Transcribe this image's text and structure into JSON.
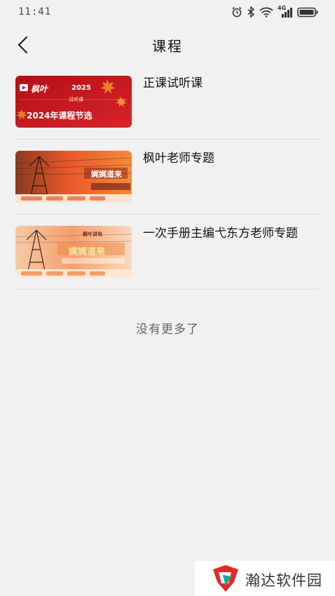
{
  "status_bar": {
    "time": "11:41",
    "icons": [
      "alarm-icon",
      "bluetooth-icon",
      "wifi-icon",
      "4g-signal-icon",
      "battery-icon"
    ],
    "network_label": "4G"
  },
  "header": {
    "title": "课程",
    "back_icon": "chevron-left-icon"
  },
  "courses": [
    {
      "title": "正课试听课",
      "thumbnail": {
        "brand": "枫叶",
        "year": "2025",
        "tag": "试听课",
        "headline": "2024年课程节选",
        "accent": "#c8171f"
      }
    },
    {
      "title": "枫叶老师专题",
      "thumbnail": {
        "headline": "娓娓道来",
        "accent": "#e8582a"
      }
    },
    {
      "title": "一次手册主编弋东方老师专题",
      "thumbnail": {
        "subtitle": "枫叶讲电",
        "headline": "娓娓道来",
        "accent": "#f08a4b"
      }
    }
  ],
  "footer_text": "没有更多了",
  "watermark": {
    "text": "瀚达软件园",
    "logo_colors": [
      "#e02a2a",
      "#1aa39a"
    ]
  }
}
